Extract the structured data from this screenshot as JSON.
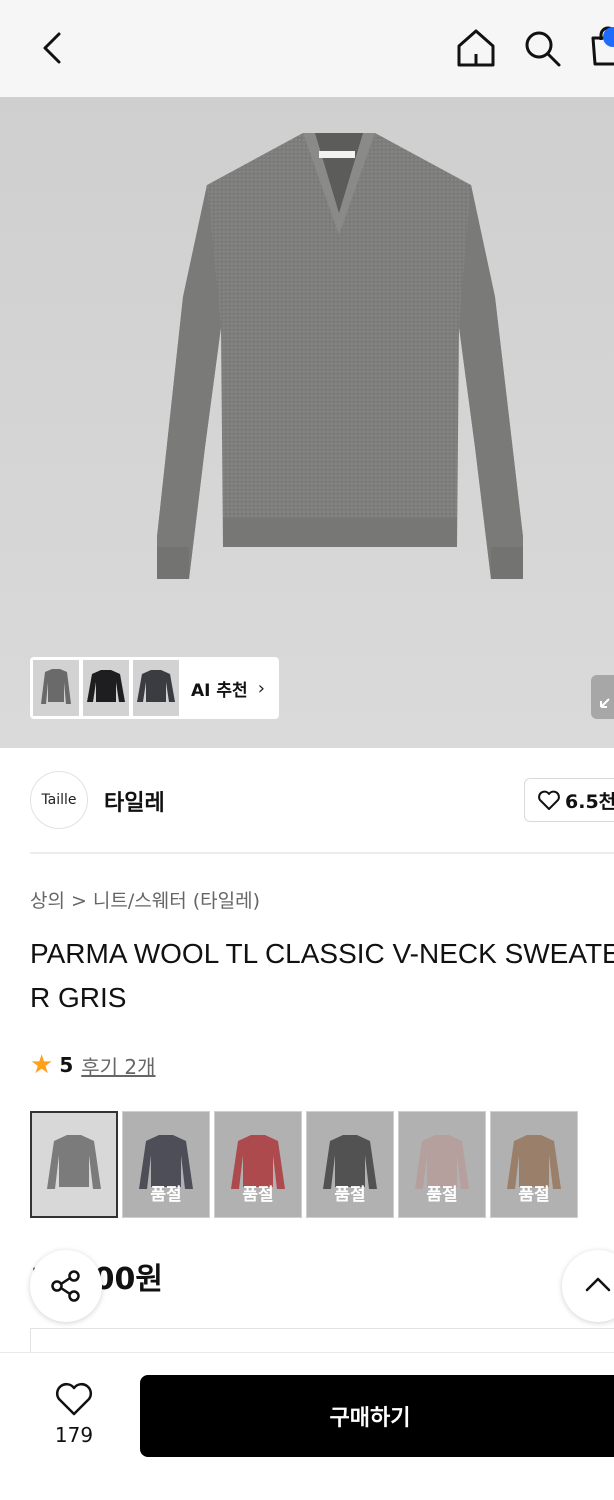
{
  "topbar": {
    "icons": [
      "back-icon",
      "home-icon",
      "search-icon",
      "shopping-bag-icon"
    ],
    "badge_color": "#1e6bff"
  },
  "hero": {
    "ai_recommend_label": "AI 추천",
    "ai_recommend_arrow": "›"
  },
  "brand": {
    "logo_text": "Taille",
    "name": "타일레",
    "like_count": "6.5천"
  },
  "breadcrumb": {
    "items": [
      "상의",
      "니트/스웨터 (타일레)"
    ],
    "separator": ">"
  },
  "product": {
    "title": "PARMA WOOL TL CLASSIC V-NECK SWEATER GRIS",
    "rating_score": "5",
    "review_label": "후기 2개",
    "price": "1 .000원"
  },
  "swatches": [
    {
      "color": "#7b7b7b",
      "soldout": false,
      "label": ""
    },
    {
      "color": "#1a1d2e",
      "soldout": true,
      "label": "품절"
    },
    {
      "color": "#c8141b",
      "soldout": true,
      "label": "품절"
    },
    {
      "color": "#242424",
      "soldout": true,
      "label": "품절"
    },
    {
      "color": "#d9b1ab",
      "soldout": true,
      "label": "품절"
    },
    {
      "color": "#a67650",
      "soldout": true,
      "label": "품절"
    }
  ],
  "bottom": {
    "wish_count": "179",
    "buy_label": "구매하기"
  },
  "colors": {
    "accent": "#000000",
    "star": "#ff9f1a"
  }
}
